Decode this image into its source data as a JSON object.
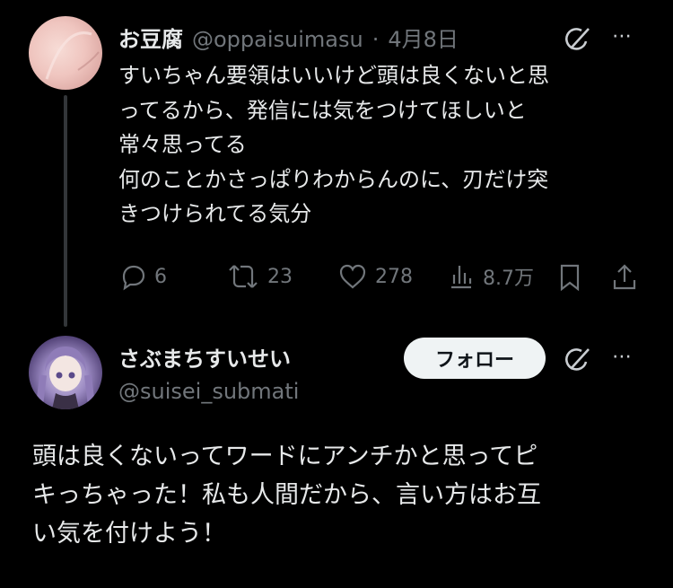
{
  "tweet1": {
    "author_name": "お豆腐",
    "author_handle": "@oppaisuimasu",
    "separator": "·",
    "date": "4月8日",
    "text": "すいちゃん要領はいいけど頭は良くないと思\nってるから、発信には気をつけてほしいと\n常々思ってる\n何のことかさっぱりわからんのに、刃だけ突\nきつけられてる気分",
    "stats": {
      "replies": "6",
      "retweets": "23",
      "likes": "278",
      "views": "8.7万"
    }
  },
  "tweet2": {
    "author_name": "さぶまちすいせい",
    "author_handle": "@suisei_submati",
    "follow_label": "フォロー",
    "text": "頭は良くないってワードにアンチかと思ってピ\nキっちゃった！私も人間だから、言い方はお互\nい気を付けよう！"
  },
  "icons": {
    "more": "⋯"
  }
}
